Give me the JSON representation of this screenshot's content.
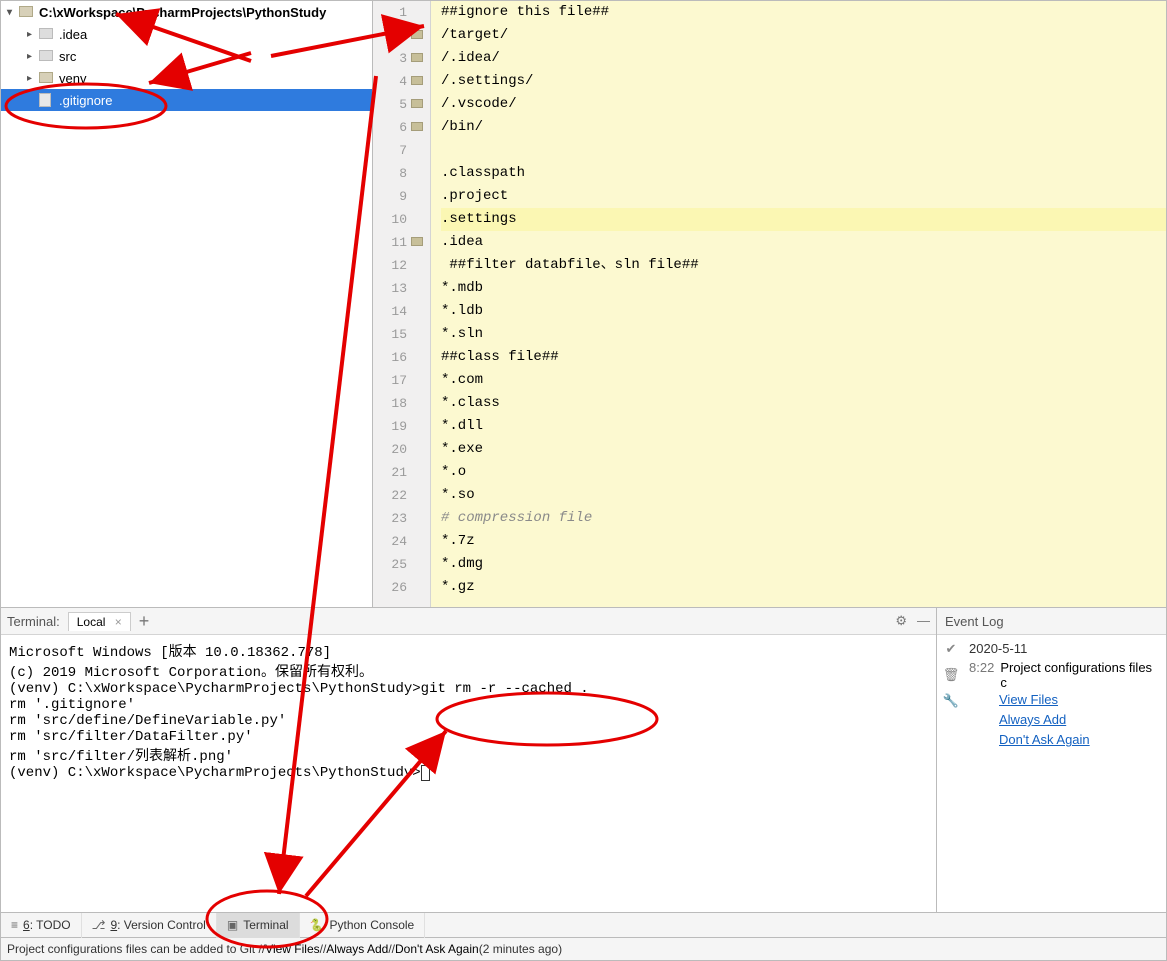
{
  "sidebar": {
    "root_label": "C:\\xWorkspace\\PycharmProjects\\PythonStudy",
    "items": [
      {
        "label": ".idea",
        "icon": "folder-grey"
      },
      {
        "label": "src",
        "icon": "folder-grey"
      },
      {
        "label": "venv",
        "icon": "folder"
      },
      {
        "label": ".gitignore",
        "icon": "file",
        "selected": true
      }
    ]
  },
  "editor": {
    "lines": [
      {
        "n": 1,
        "txt": "##ignore this file##"
      },
      {
        "n": 2,
        "txt": "/target/",
        "fold": true
      },
      {
        "n": 3,
        "txt": "/.idea/",
        "fold": true
      },
      {
        "n": 4,
        "txt": "/.settings/",
        "fold": true
      },
      {
        "n": 5,
        "txt": "/.vscode/",
        "fold": true
      },
      {
        "n": 6,
        "txt": "/bin/",
        "fold": true
      },
      {
        "n": 7,
        "txt": ""
      },
      {
        "n": 8,
        "txt": ".classpath"
      },
      {
        "n": 9,
        "txt": ".project"
      },
      {
        "n": 10,
        "txt": ".settings",
        "hl": true
      },
      {
        "n": 11,
        "txt": ".idea",
        "fold": true
      },
      {
        "n": 12,
        "txt": " ##filter databfile、sln file##"
      },
      {
        "n": 13,
        "txt": "*.mdb"
      },
      {
        "n": 14,
        "txt": "*.ldb"
      },
      {
        "n": 15,
        "txt": "*.sln"
      },
      {
        "n": 16,
        "txt": "##class file##"
      },
      {
        "n": 17,
        "txt": "*.com"
      },
      {
        "n": 18,
        "txt": "*.class"
      },
      {
        "n": 19,
        "txt": "*.dll"
      },
      {
        "n": 20,
        "txt": "*.exe"
      },
      {
        "n": 21,
        "txt": "*.o"
      },
      {
        "n": 22,
        "txt": "*.so"
      },
      {
        "n": 23,
        "txt": "# compression file",
        "comment": true
      },
      {
        "n": 24,
        "txt": "*.7z"
      },
      {
        "n": 25,
        "txt": "*.dmg"
      },
      {
        "n": 26,
        "txt": "*.gz"
      }
    ]
  },
  "terminal": {
    "title": "Terminal:",
    "tab_label": "Local",
    "lines": [
      "Microsoft Windows [版本 10.0.18362.778]",
      "(c) 2019 Microsoft Corporation。保留所有权利。",
      "",
      "(venv) C:\\xWorkspace\\PycharmProjects\\PythonStudy>git rm -r --cached .",
      "rm '.gitignore'",
      "rm 'src/define/DefineVariable.py'",
      "rm 'src/filter/DataFilter.py'",
      "rm 'src/filter/列表解析.png'",
      "",
      "(venv) C:\\xWorkspace\\PycharmProjects\\PythonStudy>"
    ]
  },
  "event_log": {
    "title": "Event Log",
    "date": "2020-5-11",
    "time": "8:22",
    "msg": "Project configurations files c",
    "links": [
      "View Files",
      "Always Add",
      "Don't Ask Again"
    ]
  },
  "tool_strip": {
    "items": [
      {
        "icon": "≡",
        "label": "6: TODO",
        "u": true
      },
      {
        "icon": "⎇",
        "label": "9: Version Control",
        "u": true
      },
      {
        "icon": "▣",
        "label": "Terminal",
        "active": true
      },
      {
        "icon": "🐍",
        "label": "Python Console"
      }
    ]
  },
  "status_bar": {
    "text_prefix": "Project configurations files can be added to Git // ",
    "link1": "View Files",
    "sep": " // ",
    "link2": "Always Add",
    "link3": "Don't Ask Again",
    "suffix": " (2 minutes ago)"
  }
}
